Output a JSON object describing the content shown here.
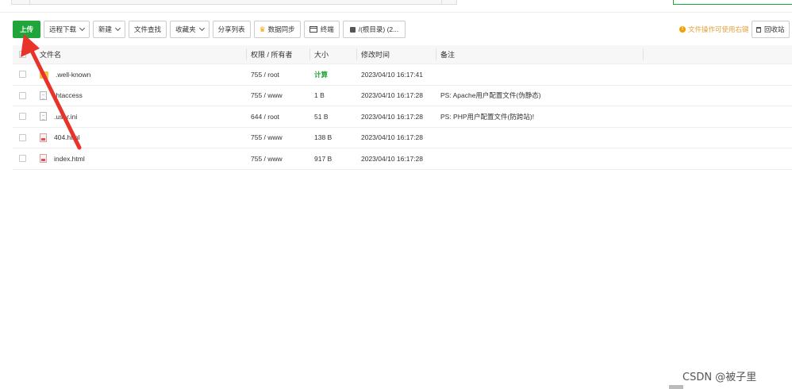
{
  "toolbar": {
    "upload": "上传",
    "remote_download": "远程下载",
    "new": "新建",
    "file_search": "文件查找",
    "favorites": "收藏夹",
    "share_list": "分享列表",
    "data_sync": "数据同步",
    "terminal": "终端",
    "path": "/(根目录) (2..."
  },
  "right_tools": {
    "tip": "文件操作可使用右键",
    "recycle_bin": "回收站"
  },
  "table": {
    "headers": {
      "name": "文件名",
      "permission": "权限 / 所有者",
      "size": "大小",
      "modified": "修改时间",
      "note": "备注"
    },
    "rows": [
      {
        "name": ".well-known",
        "type": "folder",
        "permission": "755 / root",
        "size": "计算",
        "modified": "2023/04/10 16:17:41",
        "note": ""
      },
      {
        "name": ".htaccess",
        "type": "doc",
        "permission": "755 / www",
        "size": "1 B",
        "modified": "2023/04/10 16:17:28",
        "note": "PS: Apache用户配置文件(伪静态)"
      },
      {
        "name": ".user.ini",
        "type": "doc",
        "permission": "644 / root",
        "size": "51 B",
        "modified": "2023/04/10 16:17:28",
        "note": "PS: PHP用户配置文件(防跨站)!"
      },
      {
        "name": "404.html",
        "type": "html",
        "permission": "755 / www",
        "size": "138 B",
        "modified": "2023/04/10 16:17:28",
        "note": ""
      },
      {
        "name": "index.html",
        "type": "html",
        "permission": "755 / www",
        "size": "917 B",
        "modified": "2023/04/10 16:17:28",
        "note": ""
      }
    ]
  },
  "watermark": "CSDN @被子里",
  "colors": {
    "primary": "#20a53a",
    "tip": "#e6a23c",
    "arrow": "#e8322a"
  }
}
